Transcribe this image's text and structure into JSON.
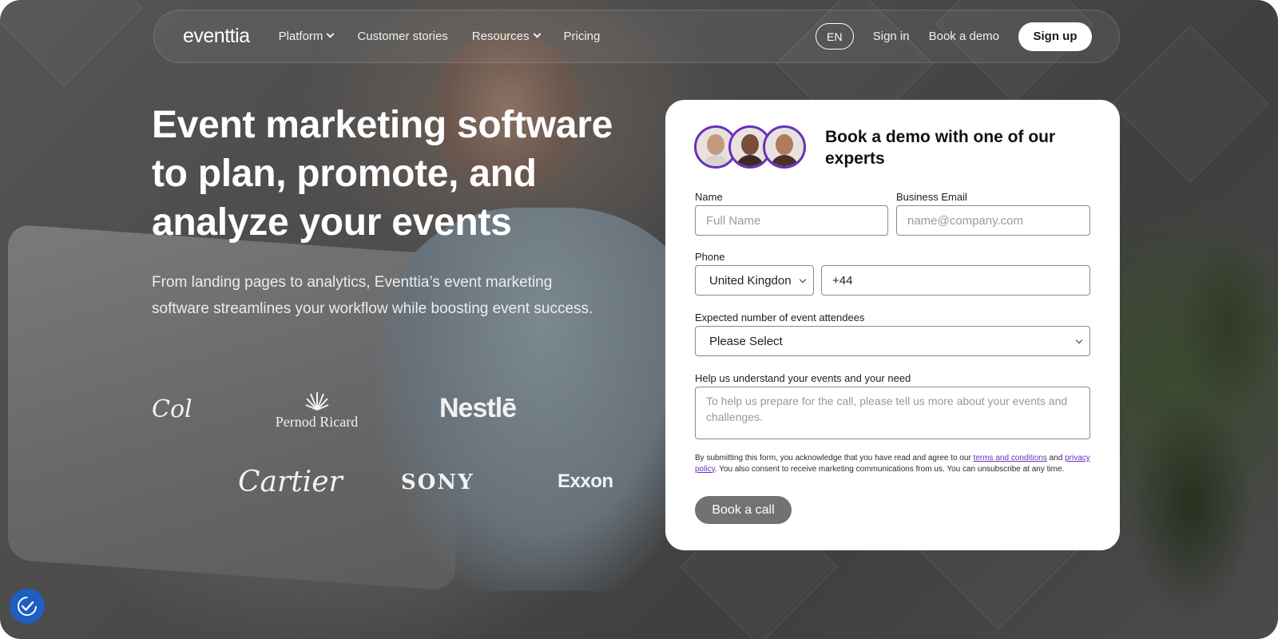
{
  "nav": {
    "logo": "eventtia",
    "links": [
      {
        "label": "Platform",
        "dropdown": true
      },
      {
        "label": "Customer stories",
        "dropdown": false
      },
      {
        "label": "Resources",
        "dropdown": true
      },
      {
        "label": "Pricing",
        "dropdown": false
      }
    ],
    "lang": "EN",
    "sign_in": "Sign in",
    "book_demo": "Book a demo",
    "sign_up": "Sign up"
  },
  "hero": {
    "title": "Event marketing software to plan, promote, and analyze your events",
    "subtitle": "From landing pages to analytics, Eventtia’s event marketing software streamlines your workflow while boosting event success."
  },
  "brands": {
    "coca_cola": "Cola",
    "pernod_ricard": "Pernod Ricard",
    "nestle": "Nestlē",
    "cartier": "Cartier",
    "sony": "SONY",
    "exxon": "Exxon"
  },
  "form": {
    "title": "Book a demo with one of our experts",
    "name_label": "Name",
    "name_placeholder": "Full Name",
    "email_label": "Business Email",
    "email_placeholder": "name@company.com",
    "phone_label": "Phone",
    "country_selected": "United Kingdon",
    "phone_value": "+44",
    "attendees_label": "Expected number of event attendees",
    "attendees_selected": "Please Select",
    "needs_label": "Help us understand your events and your need",
    "needs_placeholder": "To help us prepare for the call, please tell us more about your events and challenges.",
    "consent_prefix": "By submitting this form, you acknowledge that you have read and agree to our ",
    "terms_link": "terms and conditions",
    "consent_and": " and ",
    "privacy_link": "privacy policy",
    "consent_suffix": ". You also consent to receive marketing communications from us. You can unsubscribe at any time.",
    "submit": "Book a call",
    "accent_color": "#6b2fbd"
  },
  "icons": {
    "accessibility": "accessibility-check-icon"
  }
}
